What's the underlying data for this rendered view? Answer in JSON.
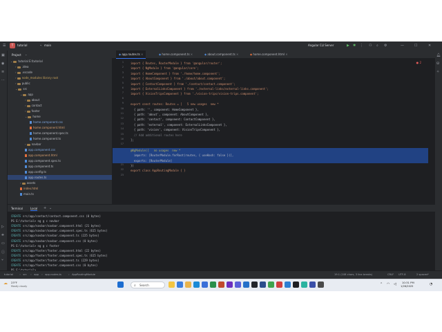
{
  "titlebar": {
    "project_badge": "T",
    "project_name": "tutorial",
    "branch": "main",
    "run_config": "Angular CLI Server"
  },
  "project_panel": {
    "title": "Project",
    "tree": [
      {
        "label": "tutorial E:\\tutorial",
        "depth": 0,
        "kind": "folder",
        "open": true
      },
      {
        "label": ".idea",
        "depth": 1,
        "kind": "folder"
      },
      {
        "label": ".vscode",
        "depth": 1,
        "kind": "folder"
      },
      {
        "label": "node_modules library root",
        "depth": 1,
        "kind": "folder"
      },
      {
        "label": "public",
        "depth": 1,
        "kind": "folder"
      },
      {
        "label": "src",
        "depth": 1,
        "kind": "folder",
        "open": true
      },
      {
        "label": "app",
        "depth": 2,
        "kind": "folder",
        "open": true
      },
      {
        "label": "about",
        "depth": 3,
        "kind": "folder"
      },
      {
        "label": "contact",
        "depth": 3,
        "kind": "folder"
      },
      {
        "label": "footer",
        "depth": 3,
        "kind": "folder"
      },
      {
        "label": "home",
        "depth": 3,
        "kind": "folder",
        "open": true
      },
      {
        "label": "home.component.css",
        "depth": 4,
        "kind": "css"
      },
      {
        "label": "home.component.html",
        "depth": 4,
        "kind": "html"
      },
      {
        "label": "home.component.spec.ts",
        "depth": 4,
        "kind": "ts"
      },
      {
        "label": "home.component.ts",
        "depth": 4,
        "kind": "ts"
      },
      {
        "label": "navbar",
        "depth": 3,
        "kind": "folder"
      },
      {
        "label": "app.component.css",
        "depth": 3,
        "kind": "css"
      },
      {
        "label": "app.component.html",
        "depth": 3,
        "kind": "html"
      },
      {
        "label": "app.component.spec.ts",
        "depth": 3,
        "kind": "ts"
      },
      {
        "label": "app.component.ts",
        "depth": 3,
        "kind": "ts"
      },
      {
        "label": "app.config.ts",
        "depth": 3,
        "kind": "ts"
      },
      {
        "label": "app.routes.ts",
        "depth": 3,
        "kind": "ts",
        "selected": true
      },
      {
        "label": "assets",
        "depth": 2,
        "kind": "folder"
      },
      {
        "label": "index.html",
        "depth": 2,
        "kind": "html"
      },
      {
        "label": "main.ts",
        "depth": 2,
        "kind": "ts"
      }
    ]
  },
  "tabs": [
    {
      "label": "app.routes.ts",
      "active": true
    },
    {
      "label": "home.component.ts",
      "active": false
    },
    {
      "label": "about.component.ts",
      "active": false
    },
    {
      "label": "home.component.html",
      "active": false
    }
  ],
  "editor": {
    "problems_count": "2",
    "lines": [
      {
        "n": "1",
        "text": "import { Routes, RouterModule } from '@angular/router';"
      },
      {
        "n": "2",
        "text": "import { NgModule } from '@angular/core';"
      },
      {
        "n": "3",
        "text": "import { HomeComponent } from './home/home.component';"
      },
      {
        "n": "4",
        "text": "import { AboutComponent } from './about/about.component';"
      },
      {
        "n": "5",
        "text": "import { ContactComponent } from './contact/contact.component';"
      },
      {
        "n": "6",
        "text": "import { ExternalLinksComponent } from './external-links/external-links.component';"
      },
      {
        "n": "7",
        "text": "import { VisionTripsComponent } from './vision-trips/vision-trips.component';"
      },
      {
        "n": "8",
        "text": ""
      },
      {
        "n": "9",
        "text": "export const routes: Routes = [   5 new usages  new *"
      },
      {
        "n": "10",
        "text": "  { path: '', component: HomeComponent },"
      },
      {
        "n": "11",
        "text": "  { path: 'about', component: AboutComponent },"
      },
      {
        "n": "12",
        "text": "  { path: 'contact', component: ContactComponent },"
      },
      {
        "n": "13",
        "text": "  { path: 'external', component: ExternalLinksComponent },"
      },
      {
        "n": "14",
        "text": "  { path: 'vision', component: VisionTripsComponent },"
      },
      {
        "n": "15",
        "text": "  // Add additional routes here"
      },
      {
        "n": "16",
        "text": "];"
      },
      {
        "n": "17",
        "text": ""
      },
      {
        "n": "18",
        "text": "@NgModule({   no usages  new *",
        "hl": true
      },
      {
        "n": "19",
        "text": "  imports: [RouterModule.forRoot(routes, { useHash: false })],",
        "hl": true
      },
      {
        "n": "20",
        "text": "  exports: [RouterModule]",
        "hl": true
      },
      {
        "n": "21",
        "text": "})"
      },
      {
        "n": "22",
        "text": "export class AppRoutingModule { }"
      },
      {
        "n": "23",
        "text": ""
      }
    ]
  },
  "terminal": {
    "tab_label": "Terminal",
    "tab_local": "Local",
    "lines": [
      {
        "pre": "CREATE",
        "text": " src/app/contact/contact.component.css (0 bytes)"
      },
      {
        "pre": "",
        "text": "PS E:\\tutorial> ng g c navbar"
      },
      {
        "pre": "CREATE",
        "text": " src/app/navbar/navbar.component.html (21 bytes)"
      },
      {
        "pre": "CREATE",
        "text": " src/app/navbar/navbar.component.spec.ts (615 bytes)"
      },
      {
        "pre": "CREATE",
        "text": " src/app/navbar/navbar.component.ts (225 bytes)"
      },
      {
        "pre": "CREATE",
        "text": " src/app/navbar/navbar.component.css (0 bytes)"
      },
      {
        "pre": "",
        "text": "PS E:\\tutorial> ng g c footer"
      },
      {
        "pre": "CREATE",
        "text": " src/app/footer/footer.component.html (22 bytes)"
      },
      {
        "pre": "CREATE",
        "text": " src/app/footer/footer.component.spec.ts (615 bytes)"
      },
      {
        "pre": "CREATE",
        "text": " src/app/footer/footer.component.ts (229 bytes)"
      },
      {
        "pre": "CREATE",
        "text": " src/app/footer/footer.component.css (0 bytes)"
      },
      {
        "pre": "",
        "text": "PS E:\\tutorial> "
      }
    ]
  },
  "statusbar": {
    "breadcrumb": [
      "tutorial",
      "src",
      "app",
      "app.routes.ts",
      "AppRoutingModule"
    ],
    "position": "19:1 (108 chars, 3 line breaks)",
    "line_sep": "CRLF",
    "encoding": "UTF-8",
    "indent": "2 spaces*"
  },
  "taskbar": {
    "weather_temp": "23°F",
    "weather_desc": "Mostly cloudy",
    "search_placeholder": "Search",
    "time": "10:31 PM",
    "date": "1/26/2025"
  }
}
